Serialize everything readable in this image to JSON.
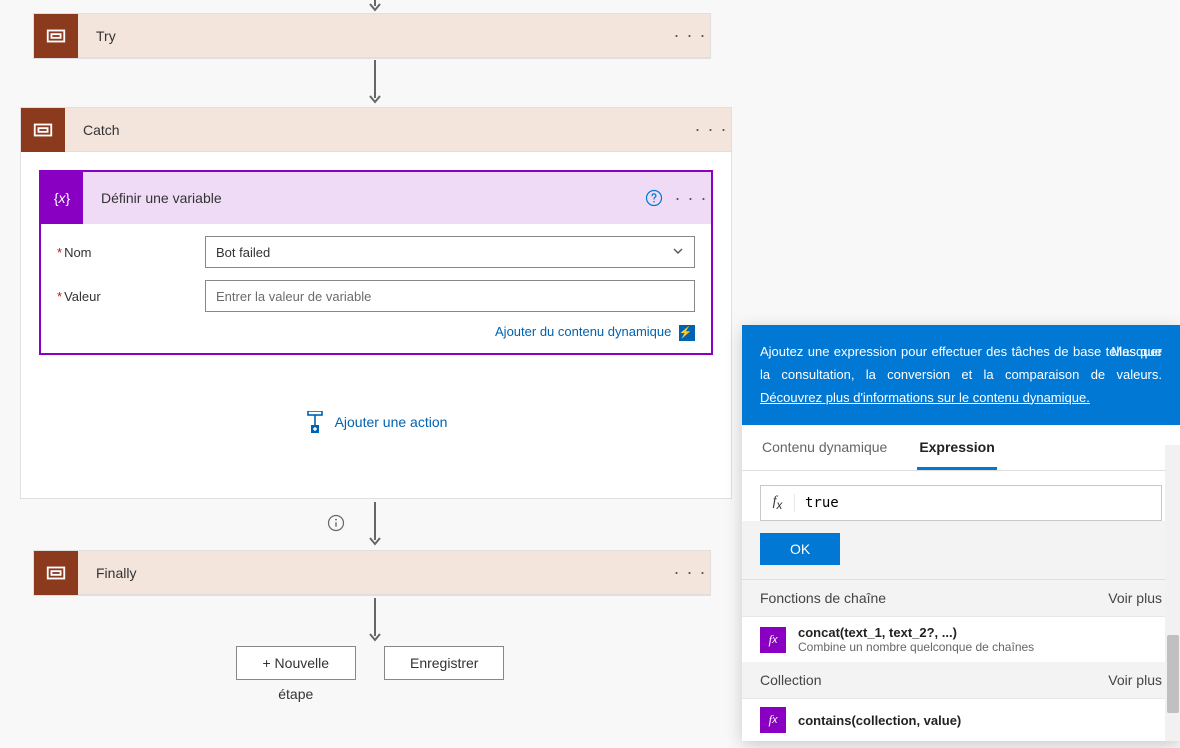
{
  "scopes": {
    "try_title": "Try",
    "catch_title": "Catch",
    "finally_title": "Finally"
  },
  "action": {
    "title": "Définir une variable",
    "name_label": "Nom",
    "name_value": "Bot failed",
    "value_label": "Valeur",
    "value_placeholder": "Entrer la valeur de variable",
    "dynamic_link": "Ajouter du contenu dynamique"
  },
  "add_action": "Ajouter une action",
  "bottom": {
    "new_step_1": "+ Nouvelle",
    "new_step_2": "étape",
    "save": "Enregistrer"
  },
  "panel": {
    "intro": "Ajoutez une expression pour effectuer des tâches de base telles que la consultation, la conversion et la comparaison de valeurs.",
    "learn_more": "Découvrez plus d'informations sur le contenu dynamique.",
    "hide": "Masquer",
    "tab_dynamic": "Contenu dynamique",
    "tab_expression": "Expression",
    "expr_value": "true",
    "ok": "OK",
    "section_string": "Fonctions de chaîne",
    "see_more": "Voir plus",
    "fn_concat_name": "concat(text_1, text_2?, ...)",
    "fn_concat_desc": "Combine un nombre quelconque de chaînes",
    "section_collection": "Collection",
    "fn_contains_name": "contains(collection, value)"
  }
}
